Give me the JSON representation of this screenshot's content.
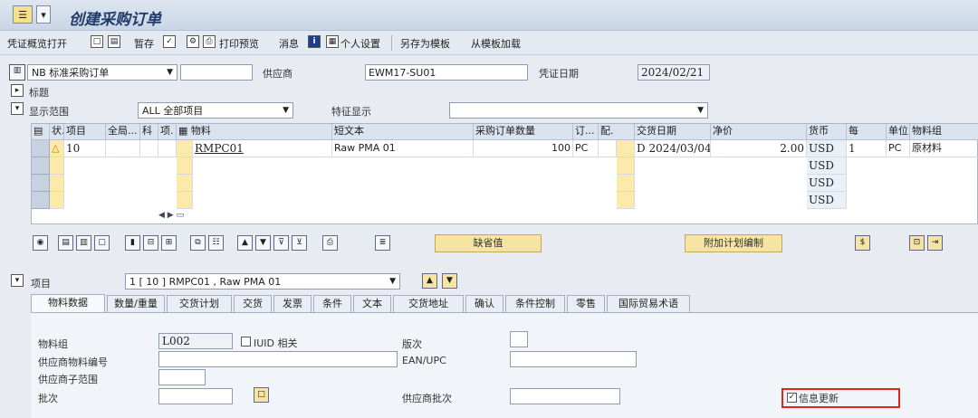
{
  "window": {
    "title": "创建采购订单"
  },
  "toolbar": {
    "items": [
      "凭证概览打开",
      "暂存",
      "打印预览",
      "消息",
      "个人设置",
      "另存为模板",
      "从模板加载"
    ]
  },
  "header": {
    "order_type": "NB 标准采购订单",
    "order_type_extra": "",
    "vendor_label": "供应商",
    "vendor_value": "EWM17-SU01",
    "doc_date_label": "凭证日期",
    "doc_date_value": "2024/02/21",
    "header_label": "标题"
  },
  "display": {
    "scope_label": "显示范围",
    "scope_value": "ALL 全部项目",
    "feature_label": "特征显示",
    "feature_value": ""
  },
  "grid": {
    "columns": [
      "状.",
      "项目",
      "全局...",
      "科",
      "项.",
      "物料",
      "短文本",
      "采购订单数量",
      "订...",
      "配.",
      "交货日期",
      "净价",
      "货币",
      "每",
      "单位",
      "物料组"
    ],
    "rows": [
      {
        "status": "△",
        "item": "10",
        "material": "RMPC01",
        "short_text": "Raw PMA 01",
        "qty": "100",
        "unit_qty": "PC",
        "d": "D",
        "delivery_date": "2024/03/04",
        "net_price": "2.00",
        "currency": "USD",
        "per": "1",
        "unit": "PC",
        "mat_group": "原材料"
      },
      {
        "currency": "USD"
      },
      {
        "currency": "USD"
      },
      {
        "currency": "USD"
      }
    ]
  },
  "functions": {
    "default_values": "缺省值",
    "additional_planning": "附加计划编制"
  },
  "item_selector": {
    "label": "项目",
    "value": "1 [ 10 ] RMPC01 , Raw PMA 01"
  },
  "tabs": [
    "物料数据",
    "数量/重量",
    "交货计划",
    "交货",
    "发票",
    "条件",
    "文本",
    "交货地址",
    "确认",
    "条件控制",
    "零售",
    "国际贸易术语"
  ],
  "material_tab": {
    "mat_group_label": "物料组",
    "mat_group_value": "L002",
    "iuid_label": "IUID 相关",
    "revision_label": "版次",
    "vendor_mat_label": "供应商物料编号",
    "ean_label": "EAN/UPC",
    "vendor_subrange_label": "供应商子范围",
    "batch_label": "批次",
    "vendor_batch_label": "供应商批次",
    "info_update_label": "信息更新",
    "info_update_checked": true
  }
}
